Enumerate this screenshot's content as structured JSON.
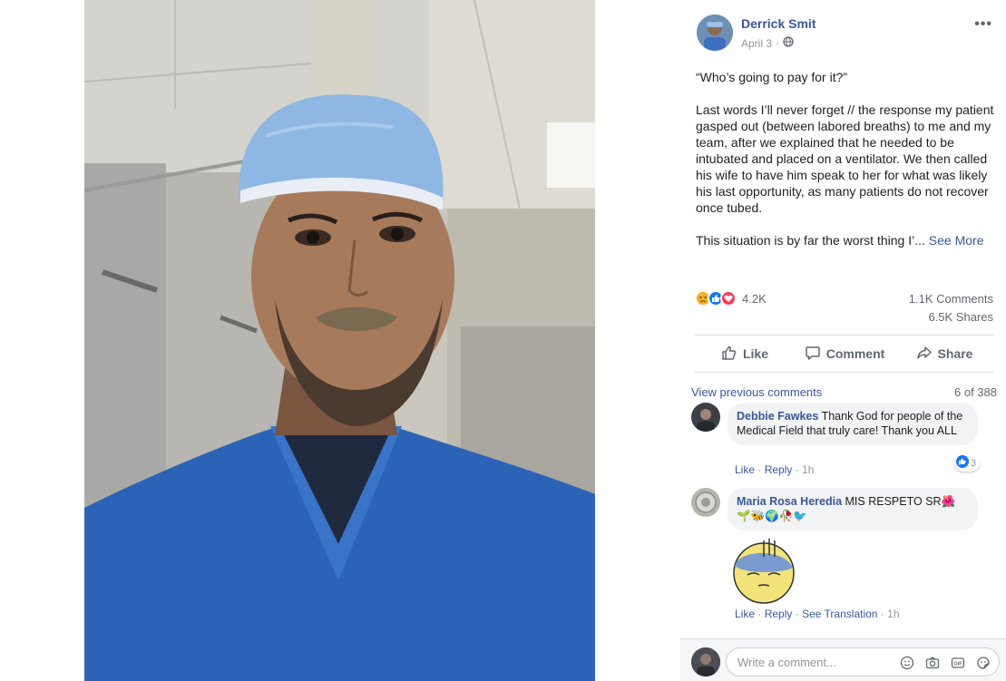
{
  "post": {
    "author": "Derrick Smit",
    "date": "April 3",
    "privacy_icon": "globe-icon",
    "more_icon": "ellipsis-icon",
    "more_label": "•••",
    "quote": "“Who’s going to pay for it?”",
    "body": "Last words I’ll never forget // the response my patient gasped out (between labored breaths) to me and my team, after we explained that he needed to be intubated and placed on a ventilator. We then called his wife to have him speak to her for what was likely his last opportunity, as many patients do not recover once tubed.",
    "preview": "This situation is by far the worst thing I’...",
    "see_more": "See More"
  },
  "stats": {
    "reactions": "4.2K",
    "comments": "1.1K Comments",
    "shares": "6.5K Shares",
    "reaction_icons": [
      "sad-icon",
      "like-icon",
      "love-icon"
    ]
  },
  "actions": {
    "like": "Like",
    "comment": "Comment",
    "share": "Share"
  },
  "comments_header": {
    "view_previous": "View previous comments",
    "page": "6 of 388"
  },
  "comments": [
    {
      "name": "Debbie Fawkes",
      "text": "Thank God for people of the Medical Field that truly care! Thank you ALL",
      "like": "Like",
      "reply": "Reply",
      "time": "1h",
      "reaction_count": "3"
    },
    {
      "name": "Maria Rosa Heredia",
      "text": "MIS RESPETO SR🌺",
      "emojis": "🌱🐝🌍🥀🐦",
      "sticker": "sad-face-sticker",
      "like": "Like",
      "reply": "Reply",
      "see_translation": "See Translation",
      "time": "1h"
    }
  ],
  "composer": {
    "placeholder": "Write a comment...",
    "icons": [
      "emoji-icon",
      "camera-icon",
      "gif-icon",
      "sticker-icon"
    ]
  },
  "colors": {
    "link": "#385898",
    "muted": "#606770",
    "bubble": "#f2f3f5",
    "like_blue": "#1877f2",
    "love_red": "#f33e58",
    "sad_yellow": "#f7b125"
  }
}
